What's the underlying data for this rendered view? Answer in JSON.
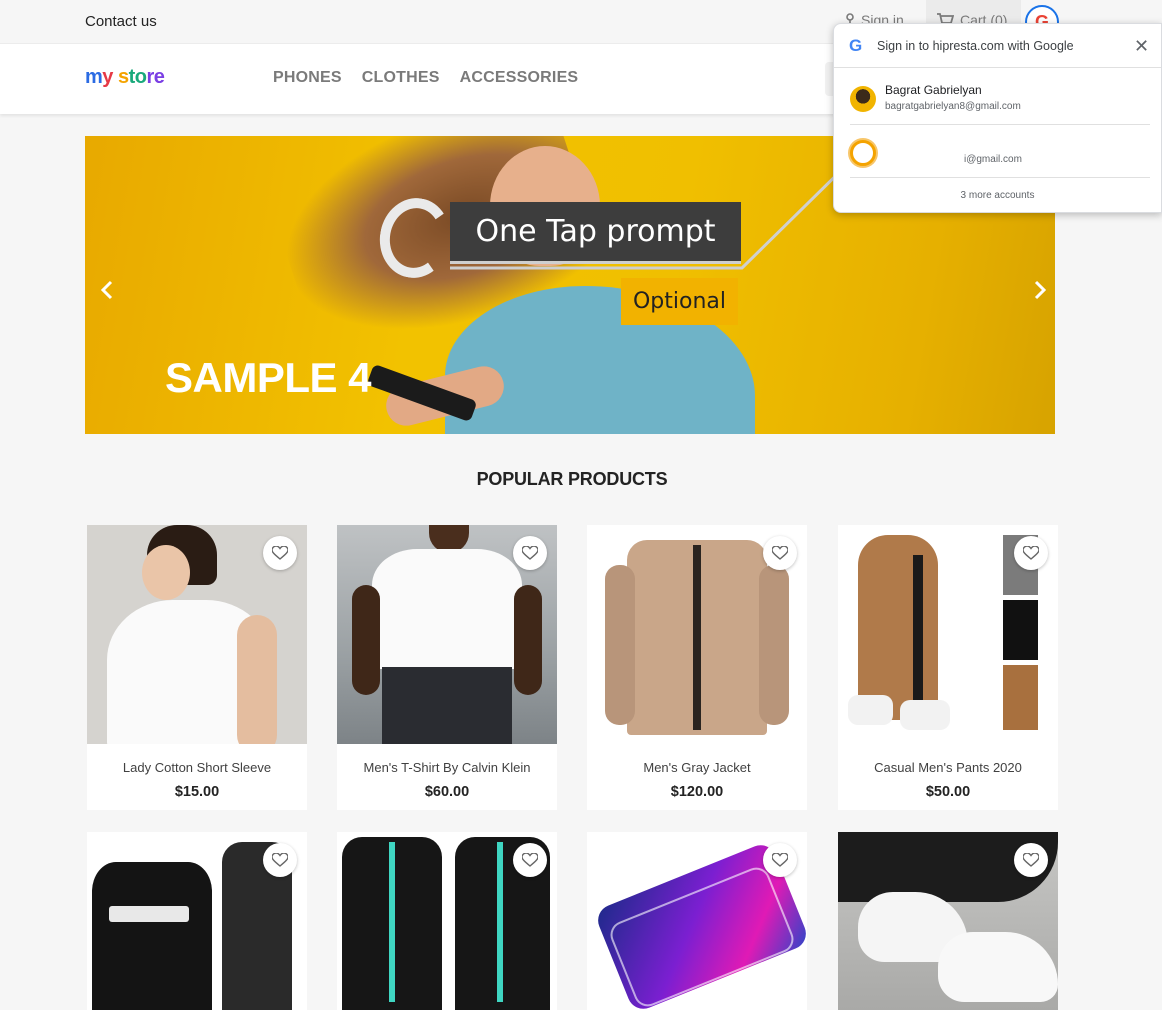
{
  "topbar": {
    "contact_label": "Contact us",
    "signin_label": "Sign in",
    "cart_label": "Cart (0)",
    "google_avatar_letter": "G"
  },
  "header": {
    "logo": {
      "part1": "m",
      "part2": "y",
      "part3": " s",
      "part4": "to",
      "part5": "re"
    },
    "nav": [
      "PHONES",
      "CLOTHES",
      "ACCESSORIES"
    ]
  },
  "hero": {
    "title": "SAMPLE 4"
  },
  "annotation": {
    "tap_prompt": "One Tap prompt",
    "optional": "Optional"
  },
  "one_tap": {
    "title": "Sign in to hipresta.com with Google",
    "accounts": [
      {
        "name": "Bagrat Gabrielyan",
        "email": "bagratgabrielyan8@gmail.com"
      },
      {
        "name": "",
        "email": "i@gmail.com"
      }
    ],
    "more_label": "3 more accounts"
  },
  "popular": {
    "title": "POPULAR PRODUCTS",
    "products": [
      {
        "name": "Lady Cotton Short Sleeve",
        "price": "$15.00"
      },
      {
        "name": "Men's T-Shirt By Calvin Klein",
        "price": "$60.00"
      },
      {
        "name": "Men's Gray Jacket",
        "price": "$120.00"
      },
      {
        "name": "Casual Men's Pants 2020",
        "price": "$50.00"
      }
    ]
  },
  "colors": {
    "google_blue": "#1a73e8",
    "hero_yellow": "#f2c200",
    "annotation_dark": "#3d3d3d",
    "annotation_yellow": "#f2b200"
  }
}
